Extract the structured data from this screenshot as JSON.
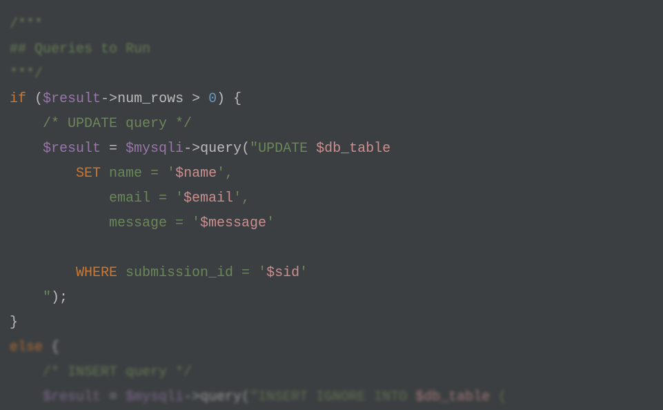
{
  "lines": {
    "l1": "/***",
    "l2": "## Queries to Run",
    "l3": "***/",
    "l4_if": "if",
    "l4_var1": "$result",
    "l4_arrow": "->",
    "l4_prop": "num_rows",
    "l4_gt": " > ",
    "l4_zero": "0",
    "l5": "    /* UPDATE query */",
    "l6_var1": "$result",
    "l6_eq": " = ",
    "l6_var2": "$mysqli",
    "l6_arrow": "->",
    "l6_method": "query",
    "l6_str1": "\"UPDATE ",
    "l6_strvar": "$db_table",
    "l7_kw": "SET",
    "l7_col": " name = '",
    "l7_var": "$name",
    "l7_end": "',",
    "l8_col": "            email = '",
    "l8_var": "$email",
    "l8_end": "',",
    "l9_col": "            message = '",
    "l9_var": "$message",
    "l9_end": "'",
    "l11_kw": "WHERE",
    "l11_col": " submission_id = '",
    "l11_var": "$sid",
    "l11_end": "'",
    "l12_str": "    \"",
    "l12_end": ");",
    "l13": "}",
    "l14_else": "else",
    "l15": "    /* INSERT query */",
    "l16_var1": "$result",
    "l16_eq": " = ",
    "l16_var2": "$mysqli",
    "l16_arrow": "->",
    "l16_method": "query",
    "l16_str1": "\"INSERT IGNORE INTO ",
    "l16_strvar": "$db_table",
    "l16_paren": " ("
  }
}
